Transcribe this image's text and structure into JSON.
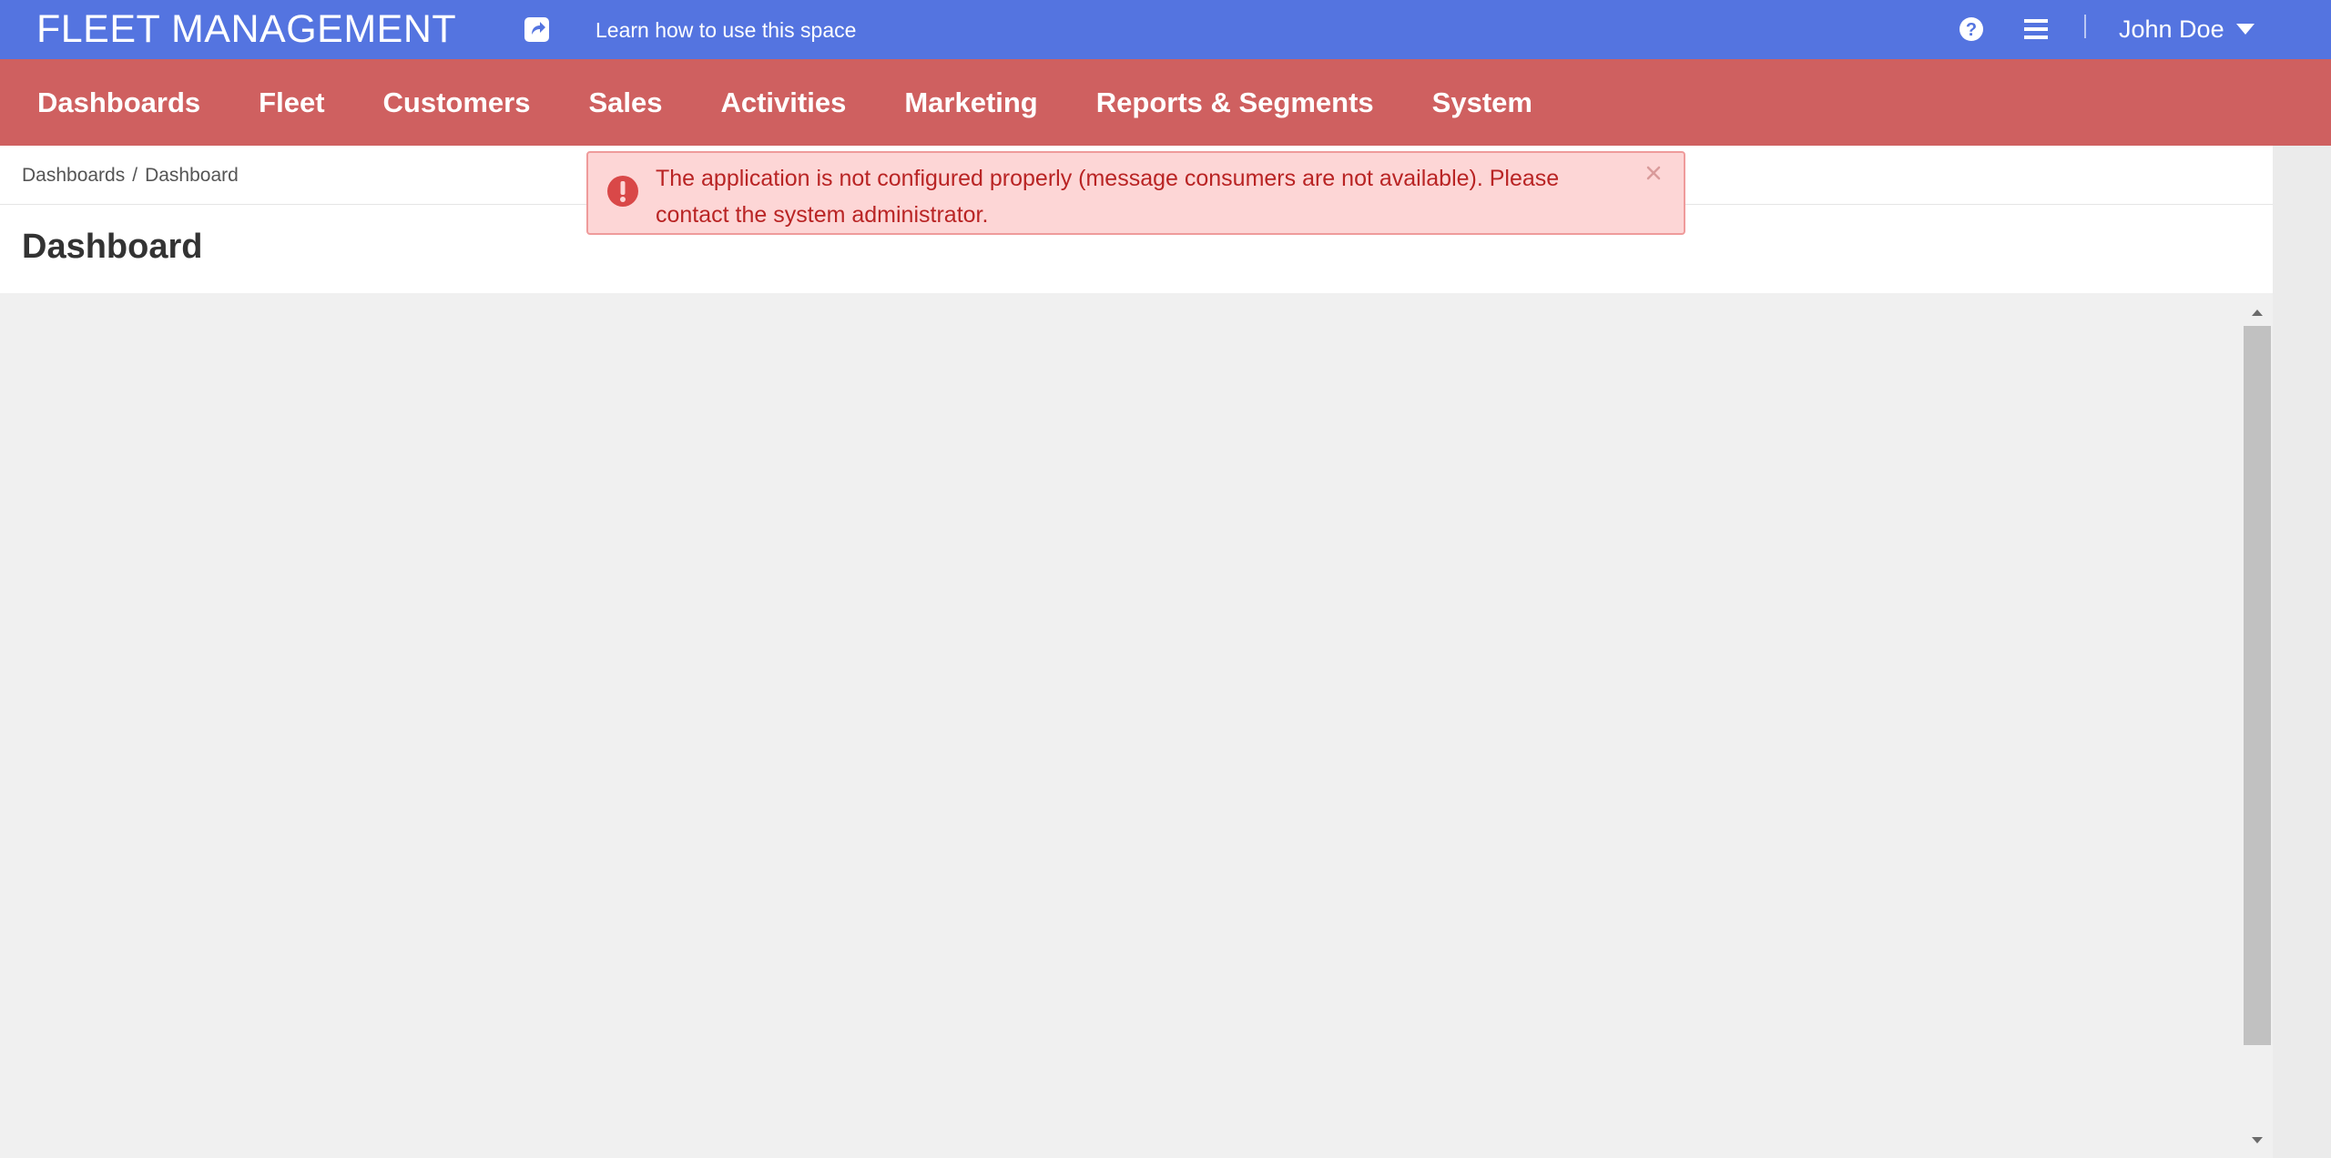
{
  "header": {
    "app_title": "FLEET MANAGEMENT",
    "learn_link": "Learn how to use this space",
    "user_name": "John Doe",
    "colors": {
      "topbar": "#5474e0",
      "nav": "#cf6060"
    },
    "icons": [
      "share-icon",
      "help-icon",
      "menu-icon",
      "caret-down-icon"
    ]
  },
  "nav": {
    "items": [
      "Dashboards",
      "Fleet",
      "Customers",
      "Sales",
      "Activities",
      "Marketing",
      "Reports & Segments",
      "System"
    ]
  },
  "breadcrumb": {
    "items": [
      "Dashboards",
      "Dashboard"
    ],
    "separator": "/"
  },
  "page": {
    "title": "Dashboard"
  },
  "alert": {
    "message": "The application is not configured properly (message consumers are not available). Please contact the system administrator.",
    "icon": "exclamation-circle-icon",
    "close_icon": "close-icon",
    "colors": {
      "background": "#fdd6d6",
      "border": "#ef9b9b",
      "text": "#b92424"
    }
  }
}
